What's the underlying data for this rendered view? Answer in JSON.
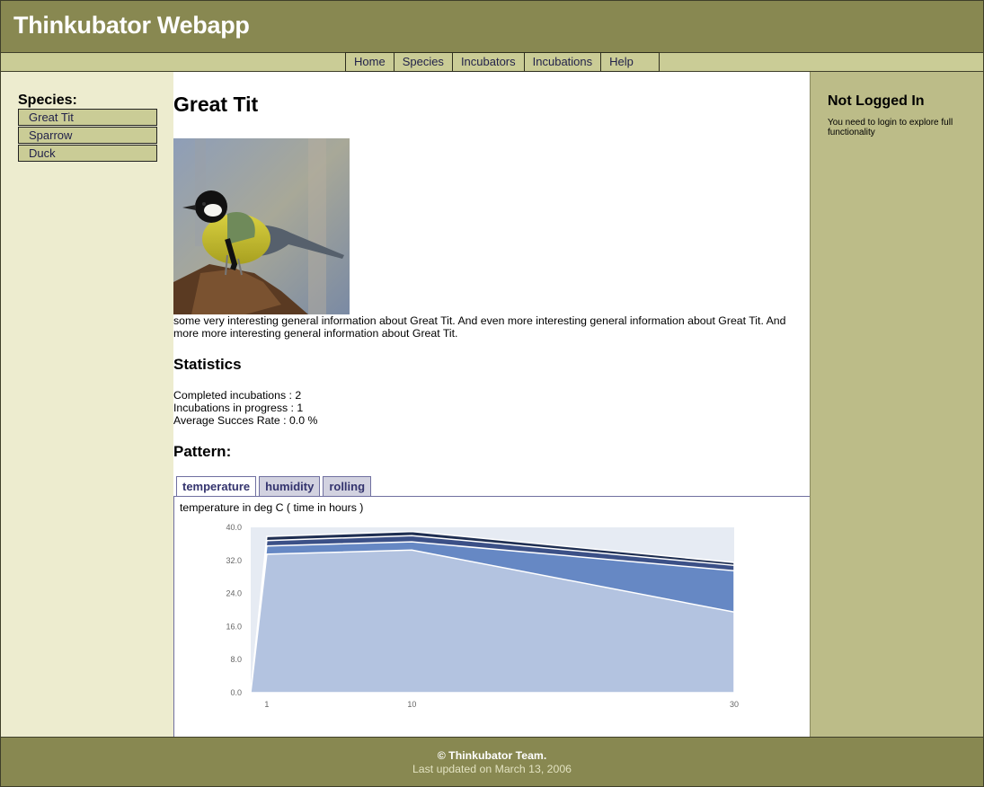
{
  "header": {
    "title": "Thinkubator Webapp"
  },
  "nav": {
    "items": [
      "Home",
      "Species",
      "Incubators",
      "Incubations",
      "Help"
    ]
  },
  "sidebar": {
    "heading": "Species:",
    "items": [
      "Great Tit",
      "Sparrow",
      "Duck"
    ]
  },
  "main": {
    "title": "Great Tit",
    "description": "some very interesting general information about Great Tit. And even more interesting general information about Great Tit. And more more interesting general information about Great Tit.",
    "stats_heading": "Statistics",
    "stats": [
      "Completed incubations : 2",
      "Incubations in progress : 1",
      "Average Succes Rate : 0.0 %"
    ],
    "pattern_heading": "Pattern:",
    "tabs": [
      "temperature",
      "humidity",
      "rolling"
    ],
    "active_tab": "temperature",
    "chart_caption": "temperature in deg C ( time in hours )"
  },
  "right": {
    "heading": "Not Logged In",
    "text": "You need to login to explore full functionality"
  },
  "footer": {
    "line1": "© Thinkubator Team.",
    "line2": "Last updated on March 13, 2006"
  },
  "colors": {
    "header_bg": "#888851",
    "nav_bg": "#cacc96",
    "left_bg": "#edeccf",
    "right_bg": "#bcbc88",
    "series_light": "#b3c3e0",
    "series_mid": "#6688c4",
    "series_dark": "#3b5087",
    "series_darkest": "#1e2e52"
  },
  "chart_data": {
    "type": "area",
    "stacked": true,
    "x": [
      1,
      10,
      30
    ],
    "xticks": [
      "1",
      "10",
      "30"
    ],
    "yticks": [
      "0.0",
      "8.0",
      "16.0",
      "24.0",
      "32.0",
      "40.0"
    ],
    "ylim": [
      0,
      40
    ],
    "series": [
      {
        "values": [
          33.5,
          34.5,
          19.5
        ],
        "color": "#b3c3e0"
      },
      {
        "values": [
          35.5,
          36.5,
          29.5
        ],
        "color": "#6688c4"
      },
      {
        "values": [
          36.8,
          38.0,
          30.8
        ],
        "color": "#3b5087"
      },
      {
        "values": [
          37.8,
          39.0,
          31.5
        ],
        "color": "#1e2e52"
      }
    ]
  }
}
